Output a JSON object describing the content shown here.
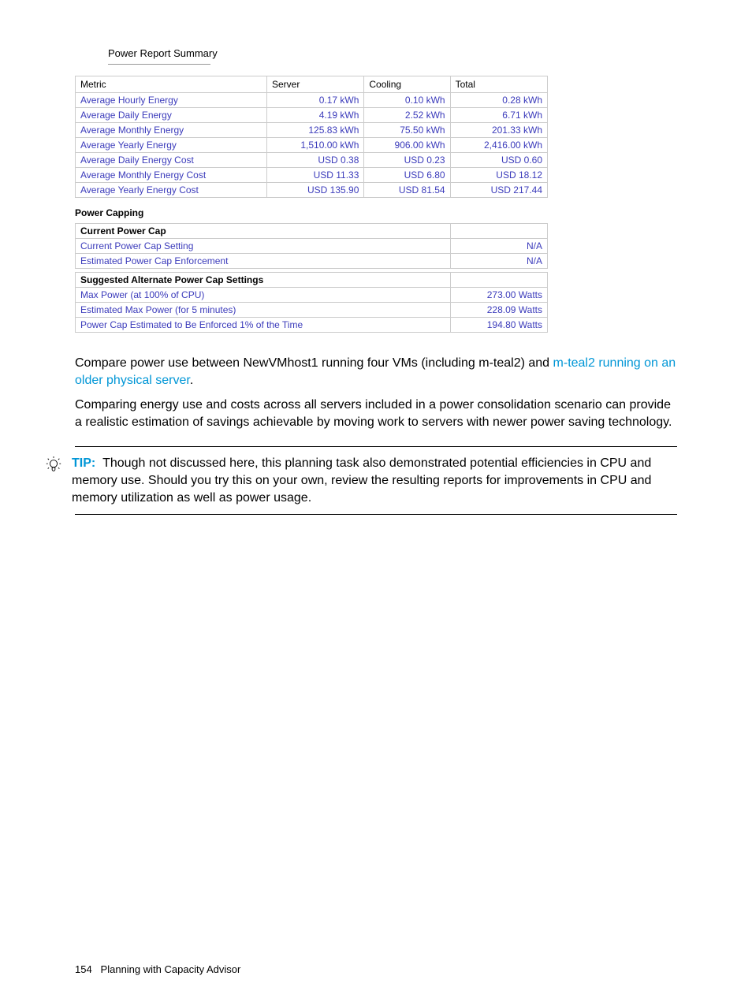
{
  "section_title": "Power Report Summary",
  "energy_table": {
    "headers": [
      "Metric",
      "Server",
      "Cooling",
      "Total"
    ],
    "rows": [
      {
        "metric": "Average Hourly Energy",
        "server": "0.17 kWh",
        "cooling": "0.10 kWh",
        "total": "0.28 kWh"
      },
      {
        "metric": "Average Daily Energy",
        "server": "4.19 kWh",
        "cooling": "2.52 kWh",
        "total": "6.71 kWh"
      },
      {
        "metric": "Average Monthly Energy",
        "server": "125.83 kWh",
        "cooling": "75.50 kWh",
        "total": "201.33 kWh"
      },
      {
        "metric": "Average Yearly Energy",
        "server": "1,510.00 kWh",
        "cooling": "906.00 kWh",
        "total": "2,416.00 kWh"
      },
      {
        "metric": "Average Daily Energy Cost",
        "server": "USD 0.38",
        "cooling": "USD 0.23",
        "total": "USD 0.60"
      },
      {
        "metric": "Average Monthly Energy Cost",
        "server": "USD 11.33",
        "cooling": "USD 6.80",
        "total": "USD 18.12"
      },
      {
        "metric": "Average Yearly Energy Cost",
        "server": "USD 135.90",
        "cooling": "USD 81.54",
        "total": "USD 217.44"
      }
    ]
  },
  "power_capping_heading": "Power Capping",
  "current_cap": {
    "header": "Current Power Cap",
    "rows": [
      {
        "label": "Current Power Cap Setting",
        "value": "N/A"
      },
      {
        "label": "Estimated Power Cap Enforcement",
        "value": "N/A"
      }
    ]
  },
  "alt_cap": {
    "header": "Suggested Alternate Power Cap Settings",
    "rows": [
      {
        "label": "Max Power (at 100% of CPU)",
        "value": "273.00 Watts"
      },
      {
        "label": "Estimated Max Power (for 5 minutes)",
        "value": "228.09 Watts"
      },
      {
        "label": "Power Cap Estimated to Be Enforced 1% of the Time",
        "value": "194.80 Watts"
      }
    ]
  },
  "paragraph1_prefix": "Compare power use between NewVMhost1 running four VMs (including m-teal2) and ",
  "paragraph1_link": "m-teal2 running on an older physical server",
  "paragraph1_suffix": ".",
  "paragraph2": "Comparing energy use and costs across all servers included in a power consolidation scenario can provide a realistic estimation of savings achievable by moving work to servers with newer power saving technology.",
  "tip_label": "TIP:",
  "tip_text": "Though not discussed here, this planning task also demonstrated potential efficiencies in CPU and memory use. Should you try this on your own, review the resulting reports for improvements in CPU and memory utilization as well as power usage.",
  "footer_page": "154",
  "footer_text": "Planning with Capacity Advisor"
}
